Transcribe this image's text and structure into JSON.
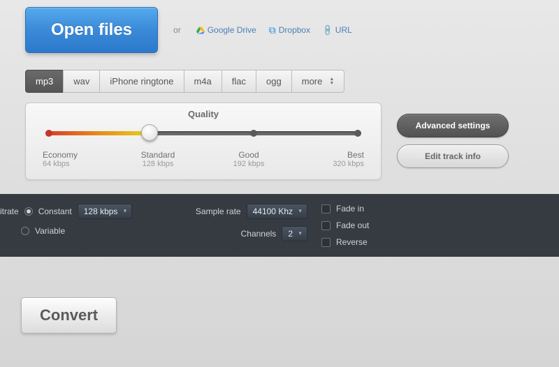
{
  "open_files_label": "Open files",
  "or_label": "or",
  "cloud": {
    "google_drive": "Google Drive",
    "dropbox": "Dropbox",
    "url": "URL"
  },
  "formats": {
    "items": [
      "mp3",
      "wav",
      "iPhone ringtone",
      "m4a",
      "flac",
      "ogg",
      "more"
    ],
    "active_index": 0
  },
  "quality": {
    "title": "Quality",
    "stops": [
      {
        "name": "Economy",
        "rate": "64 kbps"
      },
      {
        "name": "Standard",
        "rate": "128 kbps"
      },
      {
        "name": "Good",
        "rate": "192 kbps"
      },
      {
        "name": "Best",
        "rate": "320 kbps"
      }
    ],
    "selected_index": 1
  },
  "side": {
    "advanced": "Advanced settings",
    "edit_track": "Edit track info"
  },
  "advanced": {
    "bitrate_label": "itrate",
    "constant_label": "Constant",
    "variable_label": "Variable",
    "bitrate_mode": "constant",
    "bitrate_value": "128 kbps",
    "sample_rate_label": "Sample rate",
    "sample_rate_value": "44100 Khz",
    "channels_label": "Channels",
    "channels_value": "2",
    "fade_in_label": "Fade in",
    "fade_out_label": "Fade out",
    "reverse_label": "Reverse",
    "fade_in": false,
    "fade_out": false,
    "reverse": false
  },
  "convert_label": "Convert"
}
